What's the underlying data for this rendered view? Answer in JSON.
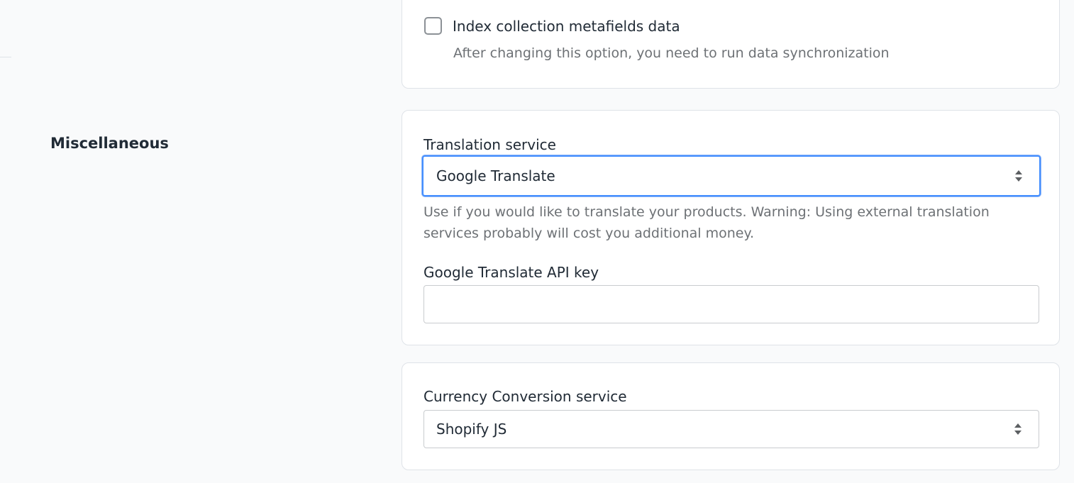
{
  "top_card": {
    "checkbox_label": "Index collection metafields data",
    "checkbox_checked": false,
    "help_text": "After changing this option, you need to run data synchronization"
  },
  "miscellaneous": {
    "section_title": "Miscellaneous",
    "translation": {
      "label": "Translation service",
      "selected_value": "Google Translate",
      "help_text": "Use if you would like to translate your products. Warning: Using external translation services probably will cost you additional money.",
      "api_key_label": "Google Translate API key",
      "api_key_value": "",
      "api_key_placeholder": ""
    },
    "currency": {
      "label": "Currency Conversion service",
      "selected_value": "Shopify JS"
    }
  },
  "colors": {
    "focus_border": "#458fff",
    "help_text": "#6d7175",
    "background": "#f9fafb"
  },
  "icons": {
    "select_arrows": "select-arrows-icon"
  }
}
